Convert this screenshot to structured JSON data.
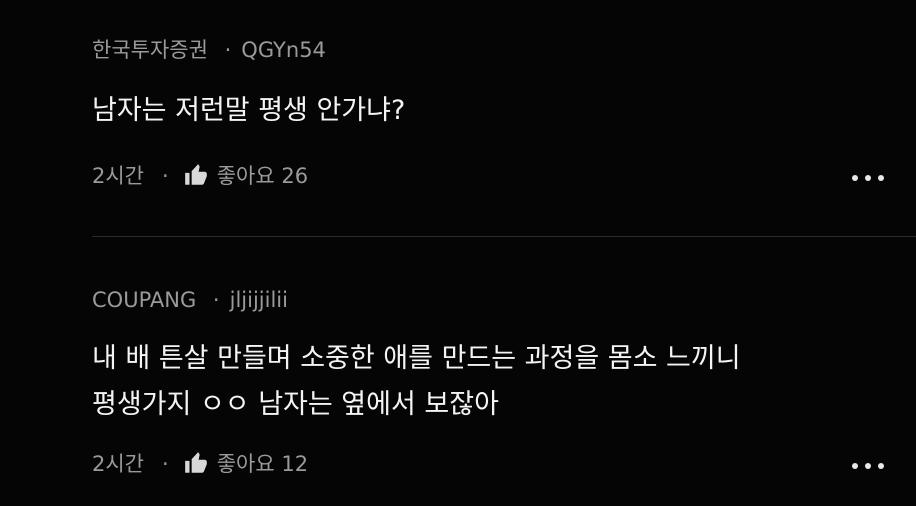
{
  "comments": [
    {
      "author": "한국투자증권",
      "separator": "·",
      "handle": "QGYn54",
      "body_lines": [
        "남자는 저런말 평생 안가냐?"
      ],
      "time": "2시간",
      "dot": "·",
      "like_label": "좋아요",
      "like_count": "26",
      "like_icon": "thumbs-up-icon",
      "more_icon": "more-dots-icon"
    },
    {
      "author": "COUPANG",
      "separator": "·",
      "handle": "jljijjilii",
      "body_lines": [
        "내 배 튼살 만들며 소중한 애를 만드는 과정을 몸소 느끼니",
        "평생가지 ㅇㅇ 남자는 옆에서 보잖아"
      ],
      "time": "2시간",
      "dot": "·",
      "like_label": "좋아요",
      "like_count": "12",
      "like_icon": "thumbs-up-icon",
      "more_icon": "more-dots-icon"
    }
  ],
  "colors": {
    "background": "#050506",
    "text_primary": "#f4f4f4",
    "text_secondary": "#9a9a9c",
    "divider": "#2a2a2c"
  }
}
